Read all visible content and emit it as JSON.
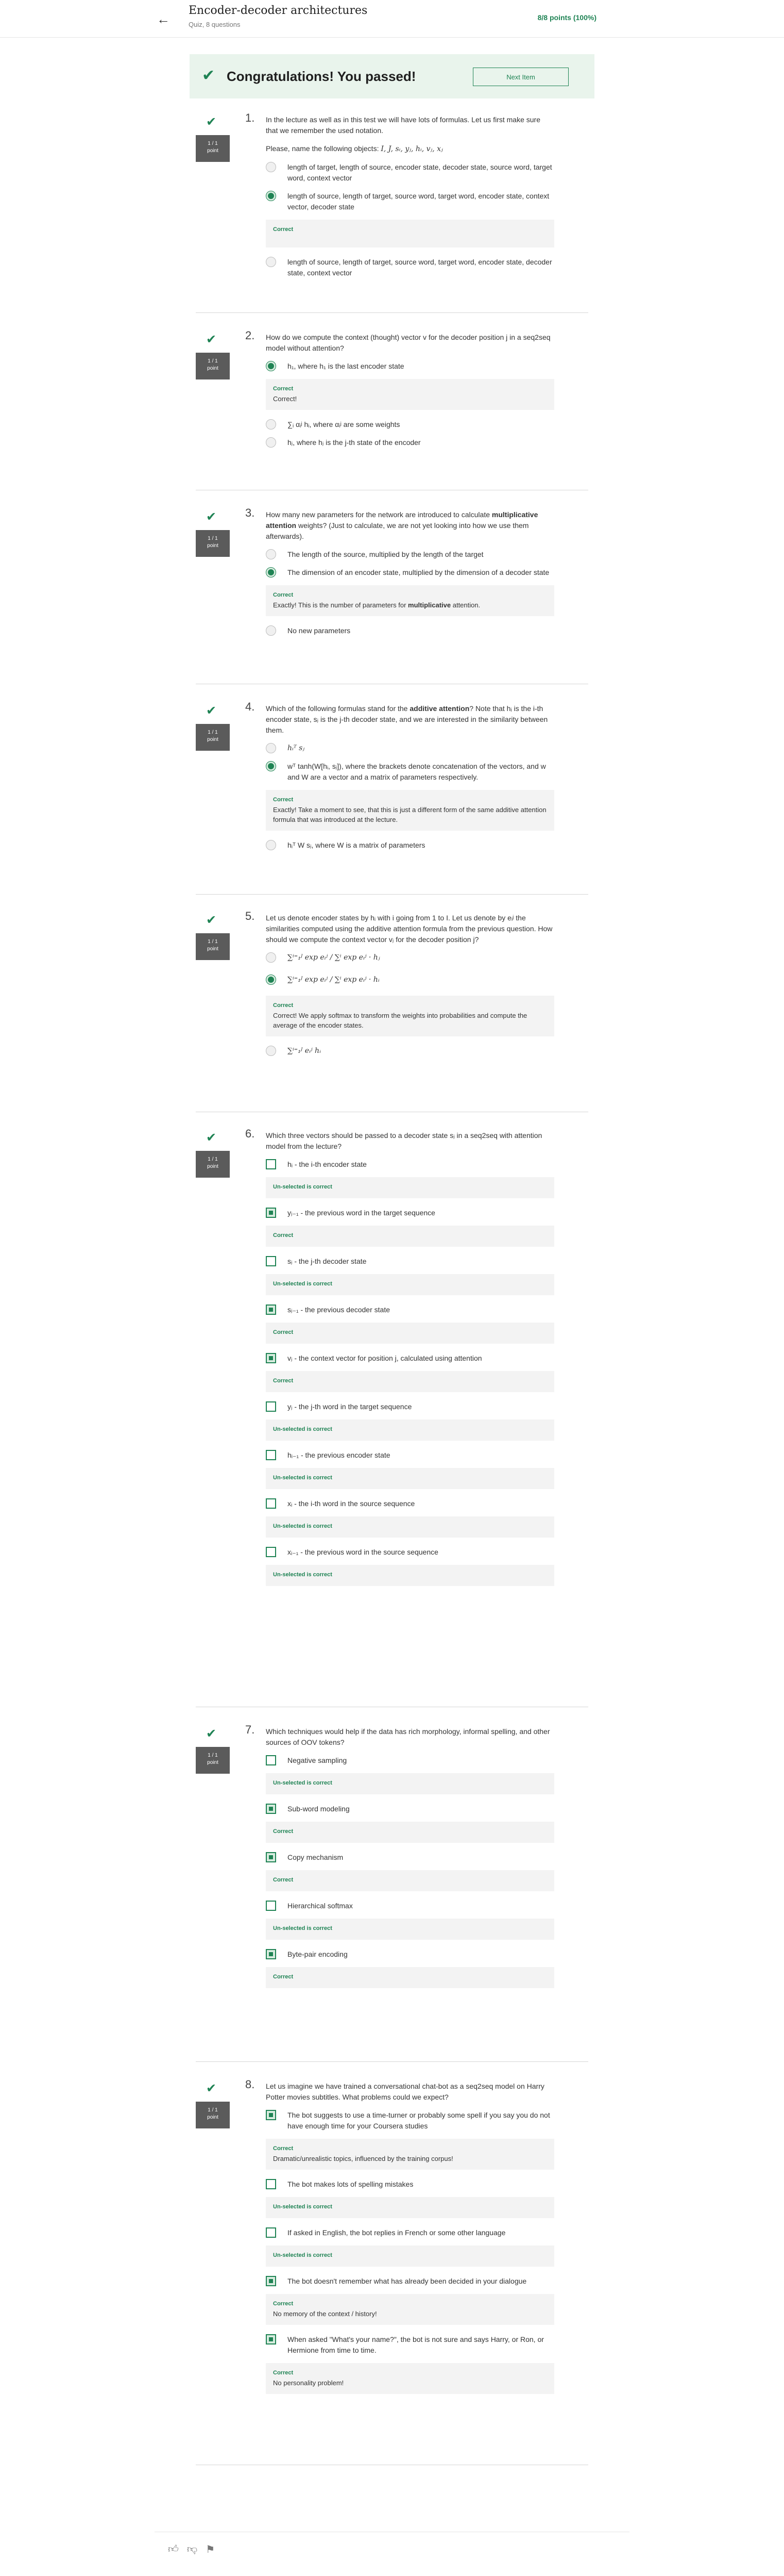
{
  "header": {
    "title": "Encoder-decoder architectures",
    "subtitle": "Quiz, 8 questions",
    "score": "8/8 points (100%)"
  },
  "banner": {
    "title": "Congratulations! You passed!",
    "next_label": "Next Item"
  },
  "point_badge": {
    "line1": "1 / 1",
    "line2": "point"
  },
  "questions": [
    {
      "number": "1.",
      "text": "In the lecture as well as in this test we will have lots of formulas. Let us first make sure that we remember the used notation.",
      "text2": "Please, name the following objects:",
      "text2_math": "I, J, sᵢ, yⱼ, hᵢ, vⱼ, xⱼ",
      "options": [
        "length of target, length of source, encoder state, decoder state, source word, target word, context vector",
        "length of source, length of target, source word, target word, encoder state, context vector, decoder state",
        "length of source, length of target, source word, target word, encoder state, decoder state, context vector"
      ],
      "feedback": {
        "heading": "Correct",
        "text": ""
      }
    },
    {
      "number": "2.",
      "text": "How do we compute the context (thought) vector v for the decoder position j in a seq2seq model without attention?",
      "options": [
        "h₁, where h₁ is the last encoder state",
        "∑ᵢ αᵢʲ hᵢ, where αᵢʲ are some weights",
        "hⱼ, where hⱼ is the j-th state of the encoder"
      ],
      "feedback": {
        "heading": "Correct",
        "text": "Correct!"
      }
    },
    {
      "number": "3.",
      "text_a": "How many new parameters for the network are introduced to calculate ",
      "text_b": "multiplicative attention",
      "text_c": " weights? (Just to calculate, we are not yet looking into how we use them afterwards).",
      "options": [
        "The length of the source, multiplied by the length of the target",
        "The dimension of an encoder state, multiplied by the dimension of a decoder state",
        "No new parameters"
      ],
      "feedback": {
        "heading": "Correct",
        "text_a": "Exactly! This is the number of parameters for ",
        "text_b": "multiplicative",
        "text_c": " attention."
      }
    },
    {
      "number": "4.",
      "text_a": "Which of the following formulas stand for the ",
      "text_b": "additive attention",
      "text_c": "? Note that hᵢ is the i-th encoder state, sⱼ is the j-th decoder state, and we are interested in the similarity between them.",
      "options": [
        "hᵢᵀ sⱼ",
        "wᵀ tanh(W[hᵢ, sⱼ]), where the brackets denote concatenation of the vectors, and w and W are a vector and a matrix of parameters respectively.",
        "hᵢᵀ W sⱼ, where W is a matrix of parameters"
      ],
      "feedback": {
        "heading": "Correct",
        "text": "Exactly! Take a moment to see, that this is just a different form of the same additive attention formula that was introduced at the lecture."
      }
    },
    {
      "number": "5.",
      "text": "Let us denote encoder states by hᵢ with i going from 1 to I. Let us denote by eᵢʲ the similarities computed using the additive attention formula from the previous question. How should we compute the context vector vⱼ for the decoder position j?",
      "options": [
        "∑ⁱ⁼₁ᴶ  exp eᵢʲ / ∑ⁱ exp eᵢʲ · hⱼ",
        "∑ⁱ⁼₁ᴶ  exp eᵢʲ / ∑ⁱ exp eᵢʲ · hᵢ",
        "∑ⁱ⁼₁ᴶ  eᵢʲ hᵢ"
      ],
      "feedback": {
        "heading": "Correct",
        "text": "Correct! We apply softmax to transform the weights into probabilities and compute the average of the encoder states."
      }
    },
    {
      "number": "6.",
      "text": "Which three vectors should be passed to a decoder state sⱼ in a seq2seq with attention model from the lecture?",
      "options": [
        "hᵢ - the i-th encoder state",
        "yⱼ₋₁ - the previous word in the target sequence",
        "sⱼ - the j-th decoder state",
        "sⱼ₋₁ - the previous decoder state",
        "vⱼ - the context vector for position j, calculated using attention",
        "yⱼ - the j-th word in the target sequence",
        "hᵢ₋₁ - the previous encoder state",
        "xᵢ - the i-th word in the source sequence",
        "xᵢ₋₁ - the previous word in the source sequence"
      ],
      "feedback": [
        "Un-selected is correct",
        "Correct",
        "Un-selected is correct",
        "Correct",
        "Correct",
        "Un-selected is correct",
        "Un-selected is correct",
        "Un-selected is correct",
        "Un-selected is correct"
      ]
    },
    {
      "number": "7.",
      "text": "Which techniques would help if the data has rich morphology, informal spelling, and other sources of OOV tokens?",
      "options": [
        "Negative sampling",
        "Sub-word modeling",
        "Copy mechanism",
        "Hierarchical softmax",
        "Byte-pair encoding"
      ],
      "feedback": [
        "Un-selected is correct",
        "Correct",
        "Correct",
        "Un-selected is correct",
        "Correct"
      ]
    },
    {
      "number": "8.",
      "text": "Let us imagine we have trained a conversational chat-bot as a seq2seq model on Harry Potter movies subtitles. What problems could we expect?",
      "options": [
        "The bot suggests to use a time-turner or probably some spell if you say you do not have enough time for your Coursera studies",
        "The bot makes lots of spelling mistakes",
        "If asked in English, the bot replies in French or some other language",
        "The bot doesn't remember what has already been decided in your dialogue",
        "When asked \"What's your name?\", the bot is not sure and says Harry, or Ron, or Hermione from time to time."
      ],
      "feedback": [
        {
          "heading": "Correct",
          "text": "Dramatic/unrealistic topics, influenced by the training corpus!"
        },
        {
          "heading": "Un-selected is correct",
          "text": ""
        },
        {
          "heading": "Un-selected is correct",
          "text": ""
        },
        {
          "heading": "Correct",
          "text": "No memory of the context / history!"
        },
        {
          "heading": "Correct",
          "text": "No personality problem!"
        }
      ]
    }
  ],
  "colors": {
    "accent": "#1f8354",
    "banner_bg": "#e9f4ec",
    "badge_bg": "#5b5b5b",
    "feedback_bg": "#f3f3f3"
  }
}
